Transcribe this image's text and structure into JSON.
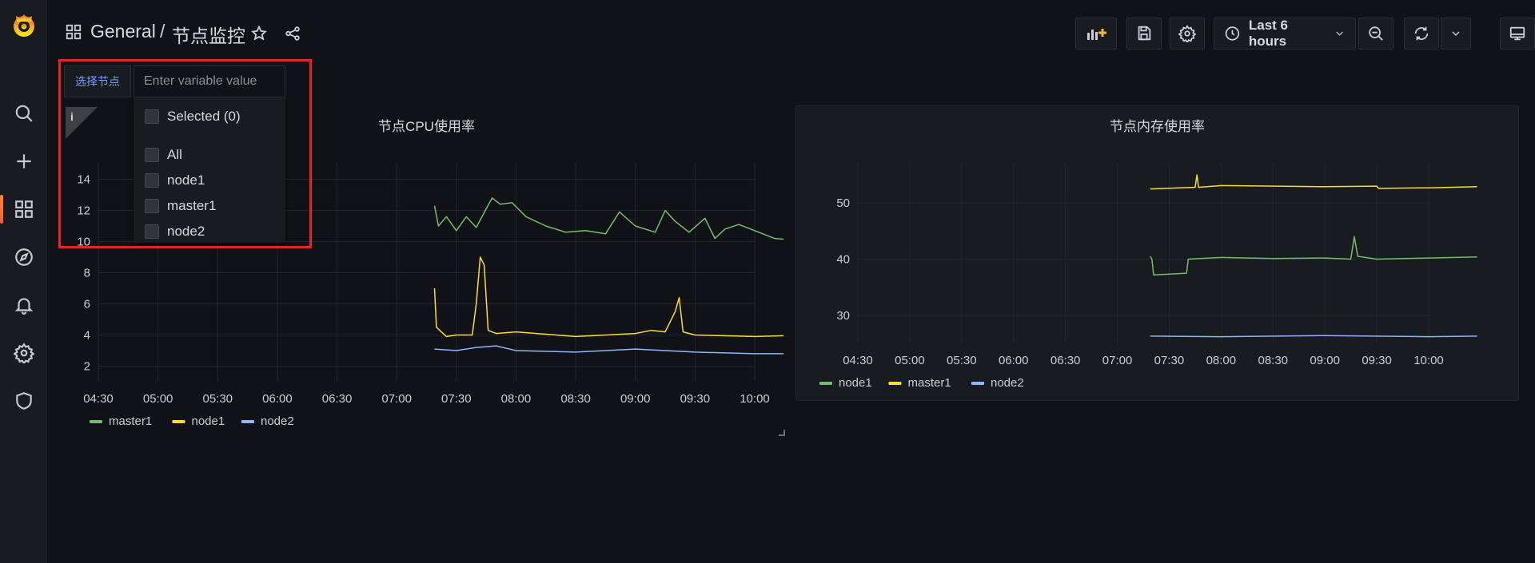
{
  "breadcrumb": {
    "folder": "General",
    "separator": "/",
    "title": "节点监控"
  },
  "toolbar": {
    "time_range": "Last 6 hours"
  },
  "variable": {
    "label": "选择节点",
    "input_placeholder": "Enter variable value",
    "options": [
      "Selected (0)",
      "All",
      "node1",
      "master1",
      "node2"
    ]
  },
  "colors": {
    "green": "#73bf69",
    "yellow": "#fade2a",
    "blue": "#8ab8ff",
    "accent": "#f55f3e",
    "highlight": "#e0242a"
  },
  "icons": {
    "sidebar": [
      "grafana-logo-icon",
      "search-icon",
      "plus-icon",
      "dashboards-icon",
      "explore-icon",
      "alerting-icon",
      "configuration-icon",
      "shield-icon"
    ],
    "nav": [
      "star-icon",
      "share-icon",
      "add-panel-icon",
      "save-icon",
      "settings-icon",
      "clock-icon",
      "zoom-out-icon",
      "refresh-icon",
      "chevron-down-icon",
      "tv-icon"
    ]
  },
  "chart_data": [
    {
      "type": "line",
      "title": "节点CPU使用率",
      "x_ticks": [
        "04:30",
        "05:00",
        "05:30",
        "06:00",
        "06:30",
        "07:00",
        "07:30",
        "08:00",
        "08:30",
        "09:00",
        "09:30",
        "10:00"
      ],
      "y_ticks": [
        2,
        4,
        6,
        8,
        10,
        12,
        14
      ],
      "ylim": [
        1,
        15
      ],
      "grid": true,
      "legend": "bottom-left",
      "series": [
        {
          "name": "master1",
          "color": "#73bf69",
          "x": [
            "07:19",
            "07:21",
            "07:25",
            "07:30",
            "07:35",
            "07:40",
            "07:45",
            "07:48",
            "07:52",
            "07:58",
            "08:05",
            "08:15",
            "08:25",
            "08:35",
            "08:45",
            "08:52",
            "09:00",
            "09:10",
            "09:15",
            "09:20",
            "09:27",
            "09:35",
            "09:40",
            "09:45",
            "09:52",
            "10:00",
            "10:10",
            "10:20",
            "10:25",
            "10:28"
          ],
          "y": [
            12.3,
            11.0,
            11.6,
            10.7,
            11.6,
            10.9,
            12.1,
            12.8,
            12.4,
            12.5,
            11.6,
            11.0,
            10.6,
            10.7,
            10.5,
            11.9,
            11.0,
            10.6,
            12.0,
            11.3,
            10.6,
            11.5,
            10.2,
            10.8,
            11.1,
            10.7,
            10.2,
            10.1,
            10.8,
            10.2
          ]
        },
        {
          "name": "node1",
          "color": "#fade2a",
          "x": [
            "07:19",
            "07:20",
            "07:25",
            "07:30",
            "07:38",
            "07:40",
            "07:42",
            "07:44",
            "07:46",
            "07:50",
            "08:00",
            "08:30",
            "09:00",
            "09:08",
            "09:15",
            "09:20",
            "09:22",
            "09:24",
            "09:30",
            "10:00",
            "10:28"
          ],
          "y": [
            7.0,
            4.5,
            3.9,
            4.0,
            4.0,
            6.0,
            9.0,
            8.5,
            4.3,
            4.1,
            4.2,
            3.9,
            4.1,
            4.3,
            4.2,
            5.5,
            6.4,
            4.2,
            4.0,
            3.9,
            4.0
          ]
        },
        {
          "name": "node2",
          "color": "#8ab8ff",
          "x": [
            "07:19",
            "07:30",
            "07:40",
            "07:50",
            "08:00",
            "08:30",
            "09:00",
            "09:30",
            "10:00",
            "10:28"
          ],
          "y": [
            3.1,
            3.0,
            3.2,
            3.3,
            3.0,
            2.9,
            3.1,
            2.9,
            2.8,
            2.8
          ]
        }
      ]
    },
    {
      "type": "line",
      "title": "节点内存使用率",
      "x_ticks": [
        "04:30",
        "05:00",
        "05:30",
        "06:00",
        "06:30",
        "07:00",
        "07:30",
        "08:00",
        "08:30",
        "09:00",
        "09:30",
        "10:00"
      ],
      "y_ticks": [
        30,
        40,
        50
      ],
      "ylim": [
        25,
        57
      ],
      "grid": true,
      "legend": "bottom-left",
      "series": [
        {
          "name": "node1",
          "color": "#73bf69",
          "x": [
            "07:19",
            "07:20",
            "07:21",
            "07:40",
            "07:41",
            "08:00",
            "08:30",
            "09:00",
            "09:15",
            "09:17",
            "09:19",
            "09:30",
            "10:00",
            "10:28"
          ],
          "y": [
            40.5,
            40.0,
            37.2,
            37.5,
            40.0,
            40.3,
            40.1,
            40.2,
            40.0,
            44.0,
            40.5,
            40.0,
            40.2,
            40.4
          ]
        },
        {
          "name": "master1",
          "color": "#fade2a",
          "x": [
            "07:19",
            "07:45",
            "07:46",
            "07:47",
            "08:00",
            "09:00",
            "09:30",
            "09:31",
            "10:00",
            "10:28"
          ],
          "y": [
            52.5,
            52.8,
            55.0,
            52.8,
            53.1,
            52.9,
            53.0,
            52.6,
            52.7,
            52.9
          ]
        },
        {
          "name": "node2",
          "color": "#8ab8ff",
          "x": [
            "07:19",
            "08:00",
            "09:00",
            "10:00",
            "10:28"
          ],
          "y": [
            26.3,
            26.2,
            26.4,
            26.2,
            26.3
          ]
        }
      ]
    }
  ]
}
